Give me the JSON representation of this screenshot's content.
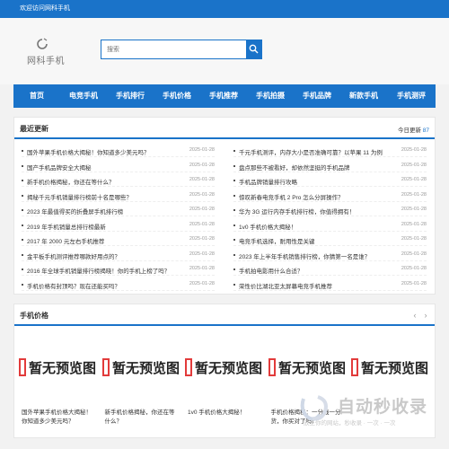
{
  "topbar": {
    "welcome": "欢迎访问网科手机"
  },
  "logo": {
    "text": "网科手机"
  },
  "search": {
    "placeholder": "搜索"
  },
  "nav": {
    "items": [
      {
        "label": "首页"
      },
      {
        "label": "电竞手机"
      },
      {
        "label": "手机排行"
      },
      {
        "label": "手机价格"
      },
      {
        "label": "手机推荐"
      },
      {
        "label": "手机拍摄"
      },
      {
        "label": "手机品牌"
      },
      {
        "label": "新款手机"
      },
      {
        "label": "手机测评"
      }
    ]
  },
  "latest": {
    "title": "最近更新",
    "today_label": "今日更新",
    "today_count": "87",
    "left": [
      {
        "title": "国外苹果手机价格大揭秘！你知道多少美元吗？",
        "date": "2025-01-28"
      },
      {
        "title": "国产手机品牌安全大揭秘",
        "date": "2025-01-28"
      },
      {
        "title": "新手机价格揭秘，你还在等什么？",
        "date": "2025-01-28"
      },
      {
        "title": "揭秘千元手机销量排行榜前十名是哪些？",
        "date": "2025-01-28"
      },
      {
        "title": "2023 年最值得买的折叠屏手机排行榜",
        "date": "2025-01-28"
      },
      {
        "title": "2019 年手机销量总排行榜最新",
        "date": "2025-01-28"
      },
      {
        "title": "2017 年 2000 元左右手机推荐",
        "date": "2025-01-28"
      },
      {
        "title": "金平板手机测评推荐哪款好用点的？",
        "date": "2025-01-28"
      },
      {
        "title": "2016 年全球手机销量排行榜揭晓！你的手机上榜了吗？",
        "date": "2025-01-28"
      },
      {
        "title": "手机价格有封顶吗？现在还能买吗？",
        "date": "2025-01-28"
      }
    ],
    "right": [
      {
        "title": "千元手机测评，内存大小是否准确可靠？以苹果 11 为例",
        "date": "2025-01-28"
      },
      {
        "title": "盘点那些不被看好，却依然坚挺的手机品牌",
        "date": "2025-01-28"
      },
      {
        "title": "手机品牌销量排行攻略",
        "date": "2025-01-28"
      },
      {
        "title": "惊叹新春电竞手机 2 Pro 怎么分屏操作？",
        "date": "2025-01-28"
      },
      {
        "title": "华为 3G 运行内存手机排行榜，你值得拥有！",
        "date": "2025-01-28"
      },
      {
        "title": "1v0 手机价格大揭秘！",
        "date": "2025-01-28"
      },
      {
        "title": "电竞手机选择，耐用性是关键",
        "date": "2025-01-28"
      },
      {
        "title": "2023 年上半年手机销售排行榜，你猜第一名是谁？",
        "date": "2025-01-28"
      },
      {
        "title": "手机拍电影用什么合适？",
        "date": "2025-01-28"
      },
      {
        "title": "荣性价比湖北亚太屏幕电竞手机推荐",
        "date": "2025-01-28"
      }
    ]
  },
  "prices": {
    "title": "手机价格",
    "prev_icon": "‹",
    "next_icon": "›",
    "placeholder_text": "暂无预览图",
    "cards": [
      {
        "caption": "国外苹果手机价格大揭秘！你知道多少美元吗？"
      },
      {
        "caption": "新手机价格揭秘，你还在等什么？"
      },
      {
        "caption": "1v0 手机价格大揭秘！"
      },
      {
        "caption": "手机价格揭秘：一分钱一分货，你买对了吗？"
      },
      {
        "caption": ""
      }
    ]
  },
  "watermark": {
    "text": "自动秒收录",
    "sub": "放上你的网站，秒收录 · 一次 · 一次"
  },
  "colors": {
    "accent": "#1a73c9",
    "placeholder_red": "#e23b3b"
  }
}
